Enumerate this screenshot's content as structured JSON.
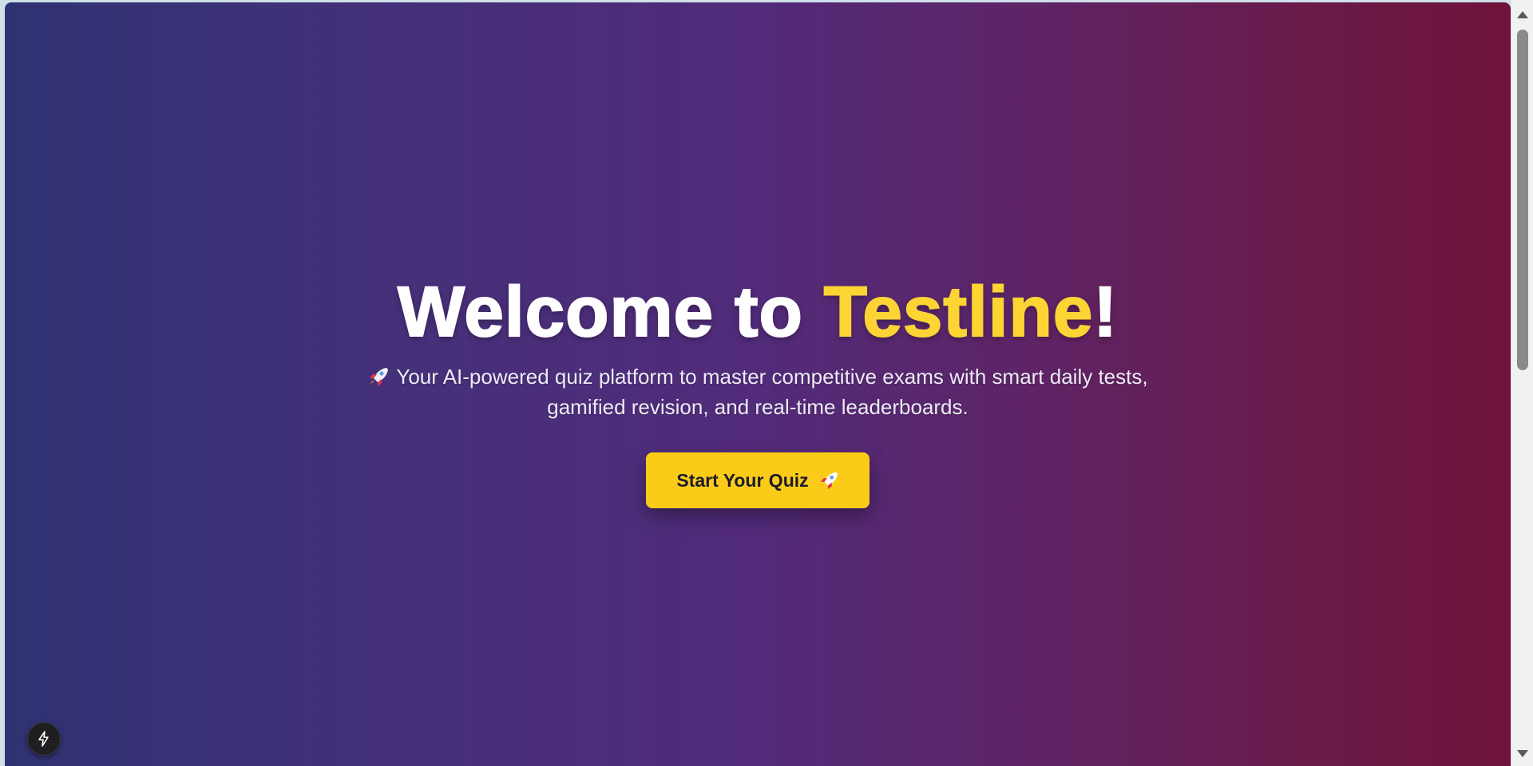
{
  "hero": {
    "title_prefix": "Welcome to ",
    "title_brand": "Testline",
    "title_suffix": "!",
    "subtitle_line1": "Your AI-powered quiz platform to master competitive exams with smart daily tests,",
    "subtitle_line2": "gamified revision, and real-time leaderboards.",
    "cta_label": "Start Your Quiz",
    "icons": {
      "subtitle": "rocket-icon",
      "cta": "rocket-icon"
    }
  },
  "floating_button": {
    "icon": "lightning-bolt-icon"
  },
  "colors": {
    "gradient_start": "#2f3272",
    "gradient_mid": "#522b7a",
    "gradient_end": "#6e133a",
    "brand_yellow": "#fcd535",
    "button_yellow": "#fbcc17",
    "button_text": "#1b1b2e"
  },
  "scrollbar": {
    "position_fraction": 0
  }
}
